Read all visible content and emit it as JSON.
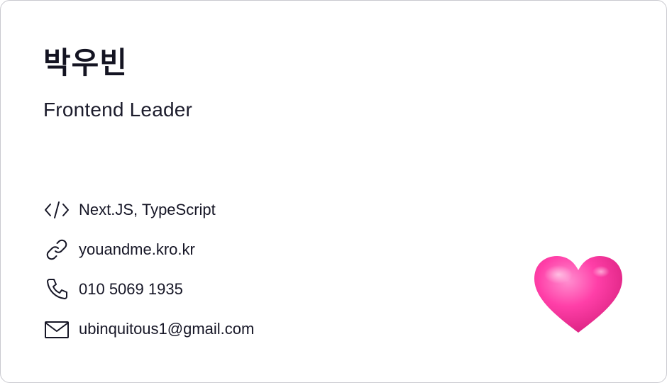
{
  "card": {
    "name": "박우빈",
    "role": "Frontend Leader",
    "info": [
      {
        "icon": "code-icon",
        "text": "Next.JS, TypeScript"
      },
      {
        "icon": "link-icon",
        "text": "youandme.kro.kr"
      },
      {
        "icon": "phone-icon",
        "text": "010 5069 1935"
      },
      {
        "icon": "mail-icon",
        "text": "ubinquitous1@gmail.com"
      }
    ],
    "decoration": "heart-emoji"
  },
  "colors": {
    "text": "#161626",
    "border": "#c9c9cf",
    "heart": "#ff3fa6"
  }
}
